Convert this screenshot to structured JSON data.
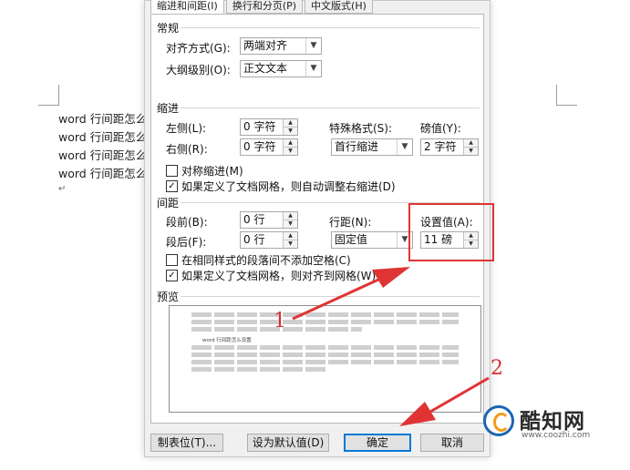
{
  "document": {
    "lines": [
      "word 行间距怎么",
      "word 行间距怎么",
      "word 行间距怎么",
      "word 行间距怎么"
    ],
    "paragraph_mark": "↵"
  },
  "dialog": {
    "tabs": [
      "缩进和间距(I)",
      "换行和分页(P)",
      "中文版式(H)"
    ],
    "general": {
      "title": "常规",
      "alignment_label": "对齐方式(G):",
      "alignment_value": "两端对齐",
      "outline_label": "大纲级别(O):",
      "outline_value": "正文文本"
    },
    "indent": {
      "title": "缩进",
      "left_label": "左侧(L):",
      "left_value": "0 字符",
      "right_label": "右侧(R):",
      "right_value": "0 字符",
      "special_label": "特殊格式(S):",
      "special_value": "首行缩进",
      "by_label": "磅值(Y):",
      "by_value": "2 字符",
      "mirror_label": "对称缩进(M)",
      "mirror_checked": false,
      "auto_adjust_label": "如果定义了文档网格，则自动调整右缩进(D)",
      "auto_adjust_checked": true
    },
    "spacing": {
      "title": "间距",
      "before_label": "段前(B):",
      "before_value": "0 行",
      "after_label": "段后(F):",
      "after_value": "0 行",
      "line_spacing_label": "行距(N):",
      "line_spacing_value": "固定值",
      "at_label": "设置值(A):",
      "at_value": "11 磅",
      "no_space_label": "在相同样式的段落间不添加空格(C)",
      "no_space_checked": false,
      "snap_grid_label": "如果定义了文档网格，则对齐到网格(W)",
      "snap_grid_checked": true
    },
    "preview": {
      "title": "预览",
      "sample_text": "word 行间距怎么设置"
    },
    "buttons": {
      "tabs": "制表位(T)...",
      "set_default": "设为默认值(D)",
      "ok": "确定",
      "cancel": "取消"
    }
  },
  "annotations": {
    "label_1": "1",
    "label_2": "2",
    "highlight_color": "#e03434"
  },
  "watermark": {
    "title": "酷知网",
    "url": "www.coozhi.com"
  },
  "icons": [
    "dropdown-arrow-icon",
    "spin-up-icon",
    "spin-down-icon",
    "checkbox-check-icon",
    "coozhi-logo-icon"
  ]
}
